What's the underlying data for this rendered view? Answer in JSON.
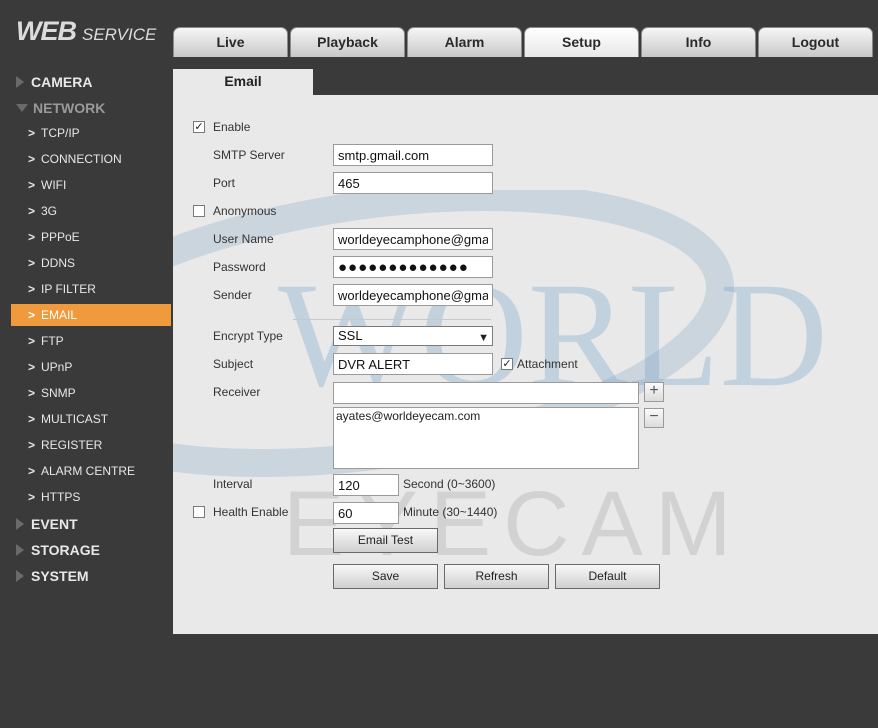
{
  "logo": {
    "primary": "WEB",
    "secondary": "SERVICE"
  },
  "tabs": [
    "Live",
    "Playback",
    "Alarm",
    "Setup",
    "Info",
    "Logout"
  ],
  "active_tab": "Setup",
  "sidebar": {
    "camera": "CAMERA",
    "network": "NETWORK",
    "network_items": [
      "TCP/IP",
      "CONNECTION",
      "WIFI",
      "3G",
      "PPPoE",
      "DDNS",
      "IP FILTER",
      "EMAIL",
      "FTP",
      "UPnP",
      "SNMP",
      "MULTICAST",
      "REGISTER",
      "ALARM CENTRE",
      "HTTPS"
    ],
    "active_item": "EMAIL",
    "event": "EVENT",
    "storage": "STORAGE",
    "system": "SYSTEM"
  },
  "page": {
    "tab_title": "Email"
  },
  "watermark": {
    "word1": "WORLD",
    "word2": "EYECAM"
  },
  "form": {
    "enable_label": "Enable",
    "enable_checked": true,
    "smtp_server_label": "SMTP Server",
    "smtp_server_value": "smtp.gmail.com",
    "port_label": "Port",
    "port_value": "465",
    "anonymous_label": "Anonymous",
    "anonymous_checked": false,
    "username_label": "User Name",
    "username_value": "worldeyecamphone@gma",
    "password_label": "Password",
    "password_value": "●●●●●●●●●●●●●",
    "sender_label": "Sender",
    "sender_value": "worldeyecamphone@gma",
    "encrypt_label": "Encrypt Type",
    "encrypt_value": "SSL",
    "subject_label": "Subject",
    "subject_value": "DVR ALERT",
    "attachment_label": "Attachment",
    "attachment_checked": true,
    "receiver_label": "Receiver",
    "receiver_input_value": "",
    "receiver_list": [
      "ayates@worldeyecam.com"
    ],
    "add_symbol": "+",
    "remove_symbol": "−",
    "interval_label": "Interval",
    "interval_value": "120",
    "interval_unit": "Second (0~3600)",
    "health_label": "Health Enable",
    "health_checked": false,
    "health_value": "60",
    "health_unit": "Minute (30~1440)",
    "check_mark": "✓"
  },
  "buttons": {
    "email_test": "Email Test",
    "save": "Save",
    "refresh": "Refresh",
    "default": "Default"
  },
  "colors": {
    "active_item_bg": "#ef9a3c",
    "chrome_bg": "#3a3a3a",
    "panel_bg": "#e9e9e9"
  }
}
